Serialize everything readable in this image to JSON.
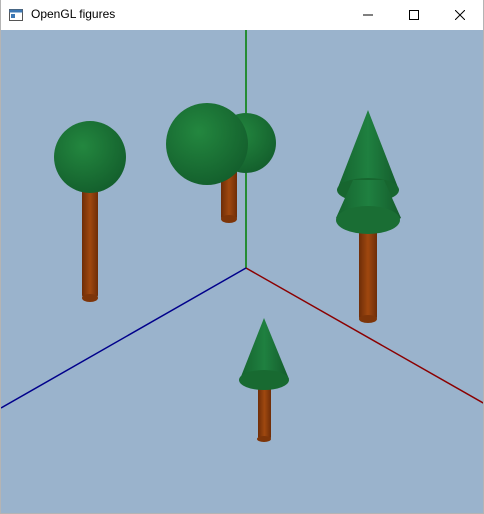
{
  "window": {
    "title": "OpenGL figures",
    "controls": [
      "minimize-icon",
      "maximize-icon",
      "close-icon"
    ]
  },
  "scene": {
    "background_color": "#9ab3cc",
    "axes": {
      "x_color": "#8b0000",
      "y_color": "#008000",
      "z_color": "#00008b"
    },
    "figures": [
      {
        "type": "round-tree",
        "trunk_color": "#8b3a0e",
        "crown_color": "#1a7a3a"
      },
      {
        "type": "round-tree-pair",
        "trunk_color": "#8b3a0e",
        "crown_color": "#1a7a3a"
      },
      {
        "type": "cone-tree",
        "trunk_color": "#8b3a0e",
        "crown_color": "#1a7a3a"
      },
      {
        "type": "cone-tree-small",
        "trunk_color": "#8b3a0e",
        "crown_color": "#1a7a3a"
      }
    ]
  }
}
